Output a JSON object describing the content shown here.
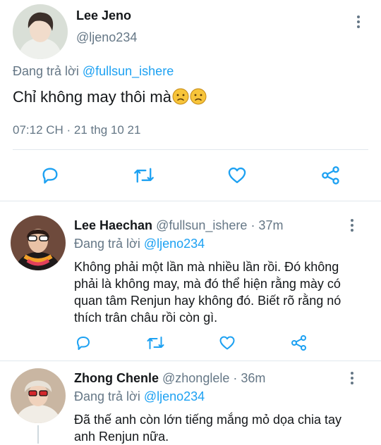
{
  "main_tweet": {
    "author_name": "Lee Jeno",
    "handle": "@ljeno234",
    "replying_to_prefix": "Đang trả lời",
    "replying_to_handle": "@fullsun_ishere",
    "text": "Chỉ không may thôi mà",
    "emoji": [
      "frowning-face-emoji",
      "frowning-face-emoji"
    ],
    "timestamp": "07:12 CH · 21 thg 10 21"
  },
  "replies": [
    {
      "author_name": "Lee Haechan",
      "handle": "@fullsun_ishere",
      "time": "· 37m",
      "replying_to_prefix": "Đang trả lời",
      "replying_to_handle": "@ljeno234",
      "text": "Không phải một lần mà nhiều lần rồi. Đó không phải là không may, mà đó thể hiện rằng mày có quan tâm Renjun hay không đó. Biết rõ rằng nó thích trân châu rồi còn gì."
    },
    {
      "author_name": "Zhong Chenle",
      "handle": "@zhonglele",
      "time": "· 36m",
      "replying_to_prefix": "Đang trả lời",
      "replying_to_handle": "@ljeno234",
      "text": "Đã thế anh còn lớn tiếng mắng mỏ dọa chia tay anh Renjun nữa."
    }
  ],
  "icons": {
    "reply": "reply-icon",
    "retweet": "retweet-icon",
    "like": "heart-icon",
    "share": "share-icon",
    "more": "more-vertical-icon"
  },
  "colors": {
    "accent": "#1da1f2",
    "secondary_text": "#657786",
    "divider": "#e1e8ed",
    "emoji_face": "#f7c43a"
  }
}
